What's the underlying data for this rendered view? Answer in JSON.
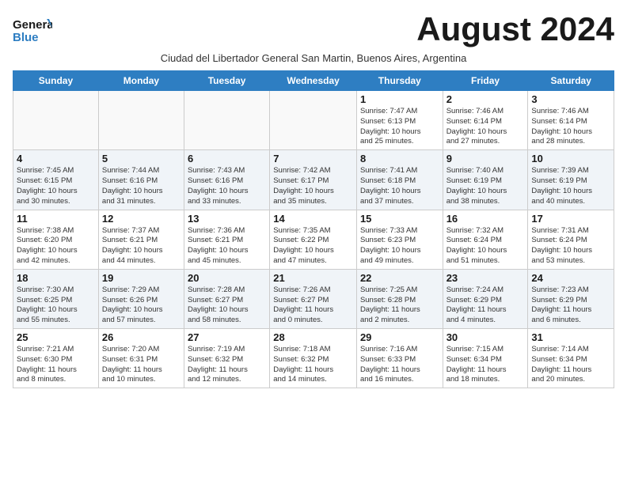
{
  "logo": {
    "line1": "General",
    "line2": "Blue"
  },
  "title": "August 2024",
  "subtitle": "Ciudad del Libertador General San Martin, Buenos Aires, Argentina",
  "days": [
    "Sunday",
    "Monday",
    "Tuesday",
    "Wednesday",
    "Thursday",
    "Friday",
    "Saturday"
  ],
  "weeks": [
    [
      {
        "date": "",
        "info": ""
      },
      {
        "date": "",
        "info": ""
      },
      {
        "date": "",
        "info": ""
      },
      {
        "date": "",
        "info": ""
      },
      {
        "date": "1",
        "info": "Sunrise: 7:47 AM\nSunset: 6:13 PM\nDaylight: 10 hours\nand 25 minutes."
      },
      {
        "date": "2",
        "info": "Sunrise: 7:46 AM\nSunset: 6:14 PM\nDaylight: 10 hours\nand 27 minutes."
      },
      {
        "date": "3",
        "info": "Sunrise: 7:46 AM\nSunset: 6:14 PM\nDaylight: 10 hours\nand 28 minutes."
      }
    ],
    [
      {
        "date": "4",
        "info": "Sunrise: 7:45 AM\nSunset: 6:15 PM\nDaylight: 10 hours\nand 30 minutes."
      },
      {
        "date": "5",
        "info": "Sunrise: 7:44 AM\nSunset: 6:16 PM\nDaylight: 10 hours\nand 31 minutes."
      },
      {
        "date": "6",
        "info": "Sunrise: 7:43 AM\nSunset: 6:16 PM\nDaylight: 10 hours\nand 33 minutes."
      },
      {
        "date": "7",
        "info": "Sunrise: 7:42 AM\nSunset: 6:17 PM\nDaylight: 10 hours\nand 35 minutes."
      },
      {
        "date": "8",
        "info": "Sunrise: 7:41 AM\nSunset: 6:18 PM\nDaylight: 10 hours\nand 37 minutes."
      },
      {
        "date": "9",
        "info": "Sunrise: 7:40 AM\nSunset: 6:19 PM\nDaylight: 10 hours\nand 38 minutes."
      },
      {
        "date": "10",
        "info": "Sunrise: 7:39 AM\nSunset: 6:19 PM\nDaylight: 10 hours\nand 40 minutes."
      }
    ],
    [
      {
        "date": "11",
        "info": "Sunrise: 7:38 AM\nSunset: 6:20 PM\nDaylight: 10 hours\nand 42 minutes."
      },
      {
        "date": "12",
        "info": "Sunrise: 7:37 AM\nSunset: 6:21 PM\nDaylight: 10 hours\nand 44 minutes."
      },
      {
        "date": "13",
        "info": "Sunrise: 7:36 AM\nSunset: 6:21 PM\nDaylight: 10 hours\nand 45 minutes."
      },
      {
        "date": "14",
        "info": "Sunrise: 7:35 AM\nSunset: 6:22 PM\nDaylight: 10 hours\nand 47 minutes."
      },
      {
        "date": "15",
        "info": "Sunrise: 7:33 AM\nSunset: 6:23 PM\nDaylight: 10 hours\nand 49 minutes."
      },
      {
        "date": "16",
        "info": "Sunrise: 7:32 AM\nSunset: 6:24 PM\nDaylight: 10 hours\nand 51 minutes."
      },
      {
        "date": "17",
        "info": "Sunrise: 7:31 AM\nSunset: 6:24 PM\nDaylight: 10 hours\nand 53 minutes."
      }
    ],
    [
      {
        "date": "18",
        "info": "Sunrise: 7:30 AM\nSunset: 6:25 PM\nDaylight: 10 hours\nand 55 minutes."
      },
      {
        "date": "19",
        "info": "Sunrise: 7:29 AM\nSunset: 6:26 PM\nDaylight: 10 hours\nand 57 minutes."
      },
      {
        "date": "20",
        "info": "Sunrise: 7:28 AM\nSunset: 6:27 PM\nDaylight: 10 hours\nand 58 minutes."
      },
      {
        "date": "21",
        "info": "Sunrise: 7:26 AM\nSunset: 6:27 PM\nDaylight: 11 hours\nand 0 minutes."
      },
      {
        "date": "22",
        "info": "Sunrise: 7:25 AM\nSunset: 6:28 PM\nDaylight: 11 hours\nand 2 minutes."
      },
      {
        "date": "23",
        "info": "Sunrise: 7:24 AM\nSunset: 6:29 PM\nDaylight: 11 hours\nand 4 minutes."
      },
      {
        "date": "24",
        "info": "Sunrise: 7:23 AM\nSunset: 6:29 PM\nDaylight: 11 hours\nand 6 minutes."
      }
    ],
    [
      {
        "date": "25",
        "info": "Sunrise: 7:21 AM\nSunset: 6:30 PM\nDaylight: 11 hours\nand 8 minutes."
      },
      {
        "date": "26",
        "info": "Sunrise: 7:20 AM\nSunset: 6:31 PM\nDaylight: 11 hours\nand 10 minutes."
      },
      {
        "date": "27",
        "info": "Sunrise: 7:19 AM\nSunset: 6:32 PM\nDaylight: 11 hours\nand 12 minutes."
      },
      {
        "date": "28",
        "info": "Sunrise: 7:18 AM\nSunset: 6:32 PM\nDaylight: 11 hours\nand 14 minutes."
      },
      {
        "date": "29",
        "info": "Sunrise: 7:16 AM\nSunset: 6:33 PM\nDaylight: 11 hours\nand 16 minutes."
      },
      {
        "date": "30",
        "info": "Sunrise: 7:15 AM\nSunset: 6:34 PM\nDaylight: 11 hours\nand 18 minutes."
      },
      {
        "date": "31",
        "info": "Sunrise: 7:14 AM\nSunset: 6:34 PM\nDaylight: 11 hours\nand 20 minutes."
      }
    ]
  ]
}
